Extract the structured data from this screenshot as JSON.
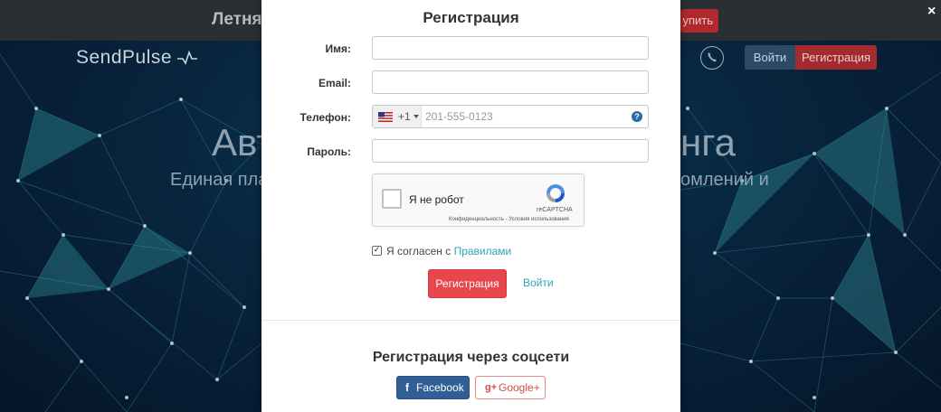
{
  "background": {
    "promo_text": "Летня",
    "promo_button": "упить",
    "close_symbol": "×",
    "logo": "SendPulse",
    "nav": {
      "login": "Войти",
      "register": "Регистрация"
    },
    "hero_title_left": "Авт",
    "hero_title_right": "нга",
    "hero_sub_left": "Единая пла",
    "hero_sub_right": "омлений и",
    "colors": {
      "accent_red": "#a52a30",
      "bg_dark": "#05152a"
    }
  },
  "modal": {
    "title": "Регистрация",
    "fields": {
      "name": {
        "label": "Имя:",
        "value": "",
        "placeholder": ""
      },
      "email": {
        "label": "Email:",
        "value": "",
        "placeholder": ""
      },
      "phone": {
        "label": "Телефон:",
        "country_code": "+1",
        "country": "US",
        "placeholder": "201-555-0123",
        "help_icon": "?"
      },
      "password": {
        "label": "Пароль:",
        "value": "",
        "placeholder": ""
      }
    },
    "captcha": {
      "label": "Я не робот",
      "brand": "reCAPTCHA",
      "links": "Конфиденциальность - Условия использования"
    },
    "agree": {
      "checked": true,
      "check_mark": "✓",
      "text": "Я согласен с ",
      "link": "Правилами"
    },
    "submit_label": "Регистрация",
    "login_link": "Войти",
    "social": {
      "title": "Регистрация через соцсети",
      "facebook": {
        "icon": "f",
        "label": "Facebook"
      },
      "google": {
        "icon": "g+",
        "label": "Google+"
      }
    },
    "colors": {
      "submit": "#e8464c",
      "link": "#2aa6b8",
      "facebook": "#2f5f94",
      "google": "#d94a4a"
    }
  }
}
